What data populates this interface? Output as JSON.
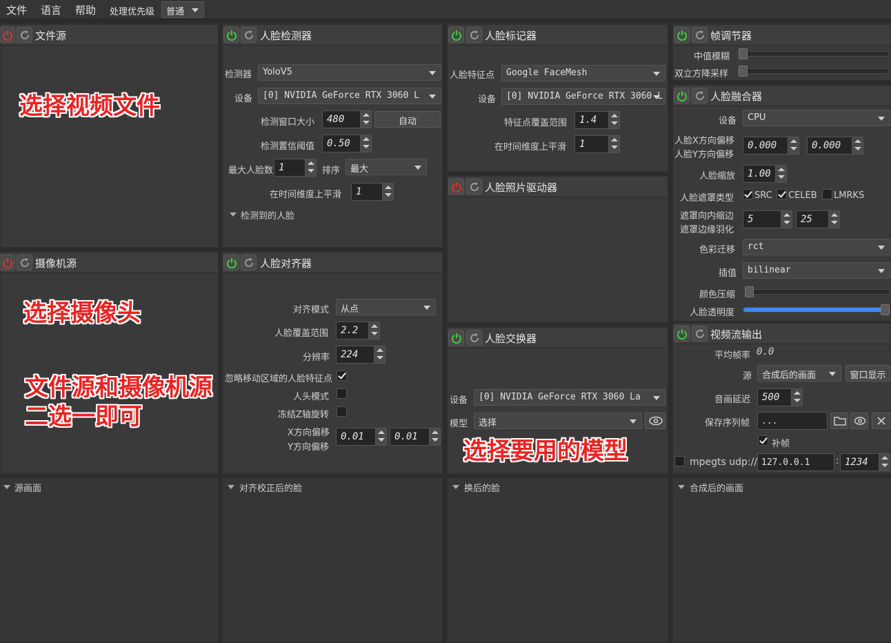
{
  "menu": {
    "file": "文件",
    "language": "语言",
    "help": "帮助",
    "priority_label": "处理优先级",
    "priority_value": "普通"
  },
  "file_source": {
    "title": "文件源"
  },
  "camera_source": {
    "title": "摄像机源"
  },
  "face_detector": {
    "title": "人脸检测器",
    "detector_label": "检测器",
    "detector_value": "YoloV5",
    "device_label": "设备",
    "device_value": "[0] NVIDIA GeForce RTX 3060 L",
    "window_label": "检测窗口大小",
    "window_value": "480",
    "auto_button": "自动",
    "threshold_label": "检测置信阈值",
    "threshold_value": "0.50",
    "max_faces_label": "最大人脸数",
    "max_faces_value": "1",
    "sort_label": "排序",
    "sort_value": "最大",
    "temporal_label": "在时间维度上平滑",
    "temporal_value": "1",
    "detected_faces": "检测到的人脸"
  },
  "face_aligner": {
    "title": "人脸对齐器",
    "mode_label": "对齐模式",
    "mode_value": "从点",
    "coverage_label": "人脸覆盖范围",
    "coverage_value": "2.2",
    "resolution_label": "分辨率",
    "resolution_value": "224",
    "ignore_label": "忽略移动区域的人脸特征点",
    "head_mode_label": "人头模式",
    "freeze_z_label": "冻结Z轴旋转",
    "x_offset_label": "X方向偏移",
    "y_offset_label": "Y方向偏移",
    "x_offset_value": "0.01",
    "y_offset_value": "0.01"
  },
  "face_marker": {
    "title": "人脸标记器",
    "landmarks_label": "人脸特征点",
    "landmarks_value": "Google FaceMesh",
    "device_label": "设备",
    "device_value": "[0] NVIDIA GeForce RTX 3060 L",
    "range_label": "特征点覆盖范围",
    "range_value": "1.4",
    "temporal_label": "在时间维度上平滑",
    "temporal_value": "1"
  },
  "face_animator": {
    "title": "人脸照片驱动器"
  },
  "face_swapper": {
    "title": "人脸交换器",
    "device_label": "设备",
    "device_value": "[0] NVIDIA GeForce RTX 3060 La",
    "model_label": "模型",
    "model_value": "选择"
  },
  "frame_adjuster": {
    "title": "帧调节器",
    "median_label": "中值模糊",
    "degrade_label": "双立方降采样"
  },
  "face_merger": {
    "title": "人脸融合器",
    "device_label": "设备",
    "device_value": "CPU",
    "x_offset_label": "人脸X方向偏移",
    "y_offset_label": "人脸Y方向偏移",
    "x_offset_value": "0.000",
    "y_offset_value": "0.000",
    "scale_label": "人脸缩放",
    "scale_value": "1.00",
    "mask_type_label": "人脸遮罩类型",
    "mask_src": "SRC",
    "mask_celeb": "CELEB",
    "mask_lmrks": "LMRKS",
    "erode_label": "遮罩向内缩边",
    "blur_label": "遮罩边缘羽化",
    "erode_value": "5",
    "blur_value": "25",
    "color_transfer_label": "色彩迁移",
    "color_transfer_value": "rct",
    "interp_label": "插值",
    "interp_value": "bilinear",
    "color_compress_label": "颜色压缩",
    "opacity_label": "人脸透明度",
    "opacity_value": 1.0
  },
  "stream_output": {
    "title": "视频流输出",
    "fps_label": "平均帧率",
    "fps_value": "0.0",
    "source_label": "源",
    "source_value": "合成后的画面",
    "window_button": "窗口显示",
    "delay_label": "音画延迟",
    "delay_value": "500",
    "save_label": "保存序列帧",
    "save_value": "...",
    "fill_frames_label": "补帧",
    "mpegts_label": "mpegts udp://",
    "mpegts_host": "127.0.0.1",
    "mpegts_sep": ":",
    "mpegts_port": "1234"
  },
  "previews": {
    "source": "源画面",
    "aligned": "对齐校正后的脸",
    "swapped": "换后的脸",
    "merged": "合成后的画面"
  },
  "annotations": {
    "a1": "选择视频文件",
    "a2": "选择摄像头",
    "a3": "文件源和摄像机源",
    "a4": "二选一即可",
    "a5": "选择要用的模型"
  },
  "colors": {
    "power_on": "#3ccf3c",
    "power_off": "#e03030",
    "accent": "#3a8ee6",
    "annotation": "#e82424"
  }
}
